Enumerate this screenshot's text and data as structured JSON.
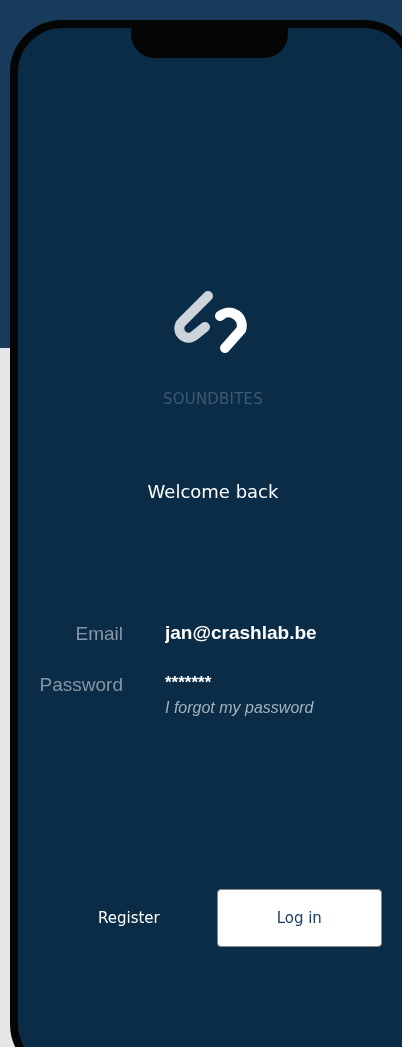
{
  "brand": {
    "name": "SOUNDBITES"
  },
  "heading": "Welcome back",
  "fields": [
    {
      "label": "Email",
      "value": "jan@crashlab.be",
      "kind": "email"
    },
    {
      "label": "Password",
      "value": "*******",
      "kind": "password"
    }
  ],
  "forgot_link": "I forgot my password",
  "buttons": [
    {
      "label": "Register",
      "kind": "secondary"
    },
    {
      "label": "Log in",
      "kind": "primary"
    }
  ]
}
